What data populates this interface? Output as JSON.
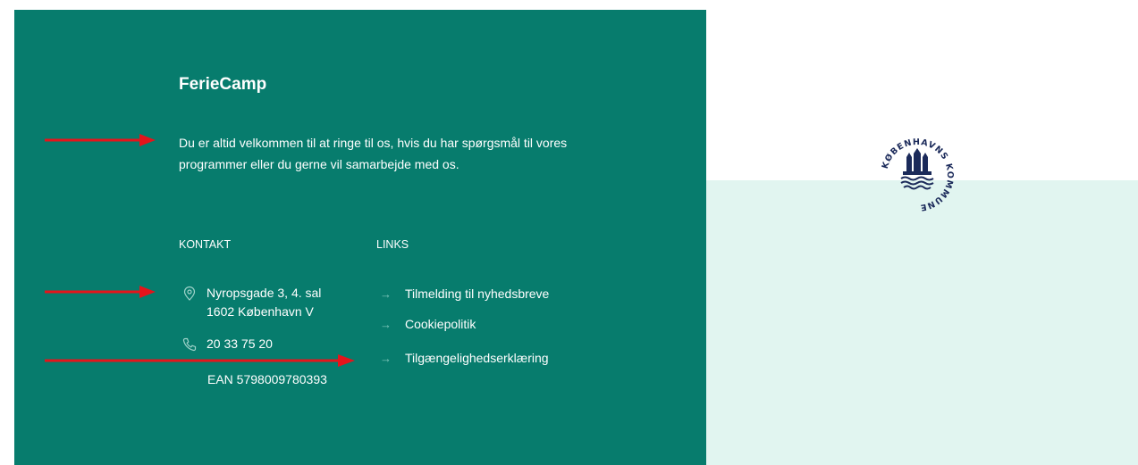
{
  "footer": {
    "brand": "FerieCamp",
    "intro_line1": "Du er altid velkommen til at ringe til os, hvis du har spørgsmål til vores",
    "intro_line2": "programmer eller du gerne vil samarbejde med os.",
    "kontakt": {
      "title": "KONTAKT",
      "address_line1": "Nyropsgade 3, 4. sal",
      "address_line2": "1602 København V",
      "phone": "20 33 75 20",
      "ean": "EAN 5798009780393"
    },
    "links": {
      "title": "LINKS",
      "items": [
        {
          "label": "Tilmelding til nyhedsbreve"
        },
        {
          "label": "Cookiepolitik"
        },
        {
          "label": "Tilgængelighedserklæring"
        }
      ]
    }
  },
  "logo": {
    "text": "KØBENHAVNS KOMMUNE"
  },
  "colors": {
    "footer_bg": "#077c6d",
    "side_bg": "#e1f5f0",
    "annotation_arrow": "#e5141b",
    "logo_navy": "#1b2a5a"
  },
  "icons": [
    "location-pin-icon",
    "phone-icon",
    "arrow-right-icon",
    "kobenhavns-kommune-logo"
  ]
}
